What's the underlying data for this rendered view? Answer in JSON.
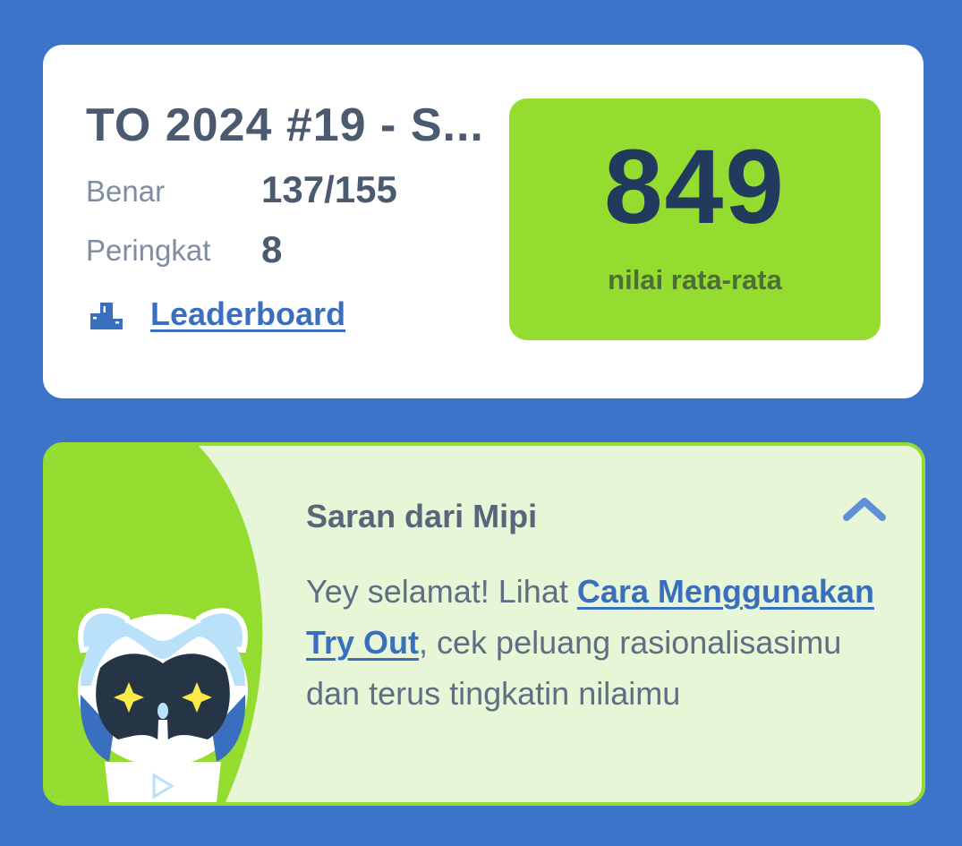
{
  "result": {
    "title": "TO 2024 #19 - S...",
    "correct_label": "Benar",
    "correct_value": "137/155",
    "rank_label": "Peringkat",
    "rank_value": "8",
    "leaderboard_link": "Leaderboard",
    "score": "849",
    "score_caption": "nilai rata-rata"
  },
  "advice": {
    "title": "Saran dari Mipi",
    "text_before_link": "Yey selamat! Lihat ",
    "link_text": "Cara Menggunakan Try Out",
    "text_after_link": ", cek peluang rasionalisasimu dan terus tingkatin nilaimu"
  },
  "icons": {
    "leaderboard": "podium-icon",
    "collapse": "chevron-up-icon",
    "mascot": "mipi-robot-mascot"
  },
  "colors": {
    "background": "#3b74c8",
    "card": "#ffffff",
    "score_box": "#94dc30",
    "score_text": "#223a5e",
    "advice_bg": "#e6f6d6",
    "accent_link": "#3a6fbf"
  }
}
